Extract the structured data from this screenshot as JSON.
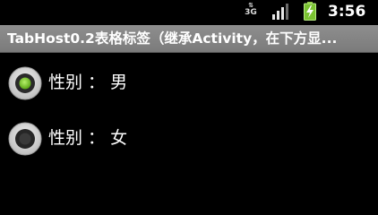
{
  "status_bar": {
    "network_label": "3G",
    "time": "3:56",
    "icons": [
      "3g-data-icon",
      "signal-strength-icon",
      "battery-charging-icon"
    ]
  },
  "title_bar": {
    "title": "TabHost0.2表格标签（继承Activity，在下方显..."
  },
  "radio_group": {
    "options": [
      {
        "label": "性别 ： 男",
        "checked": true
      },
      {
        "label": "性别 ： 女",
        "checked": false
      }
    ]
  },
  "colors": {
    "background": "#000000",
    "title_bar": "#858585",
    "radio_checked": "#7ed321",
    "text": "#ffffff"
  }
}
